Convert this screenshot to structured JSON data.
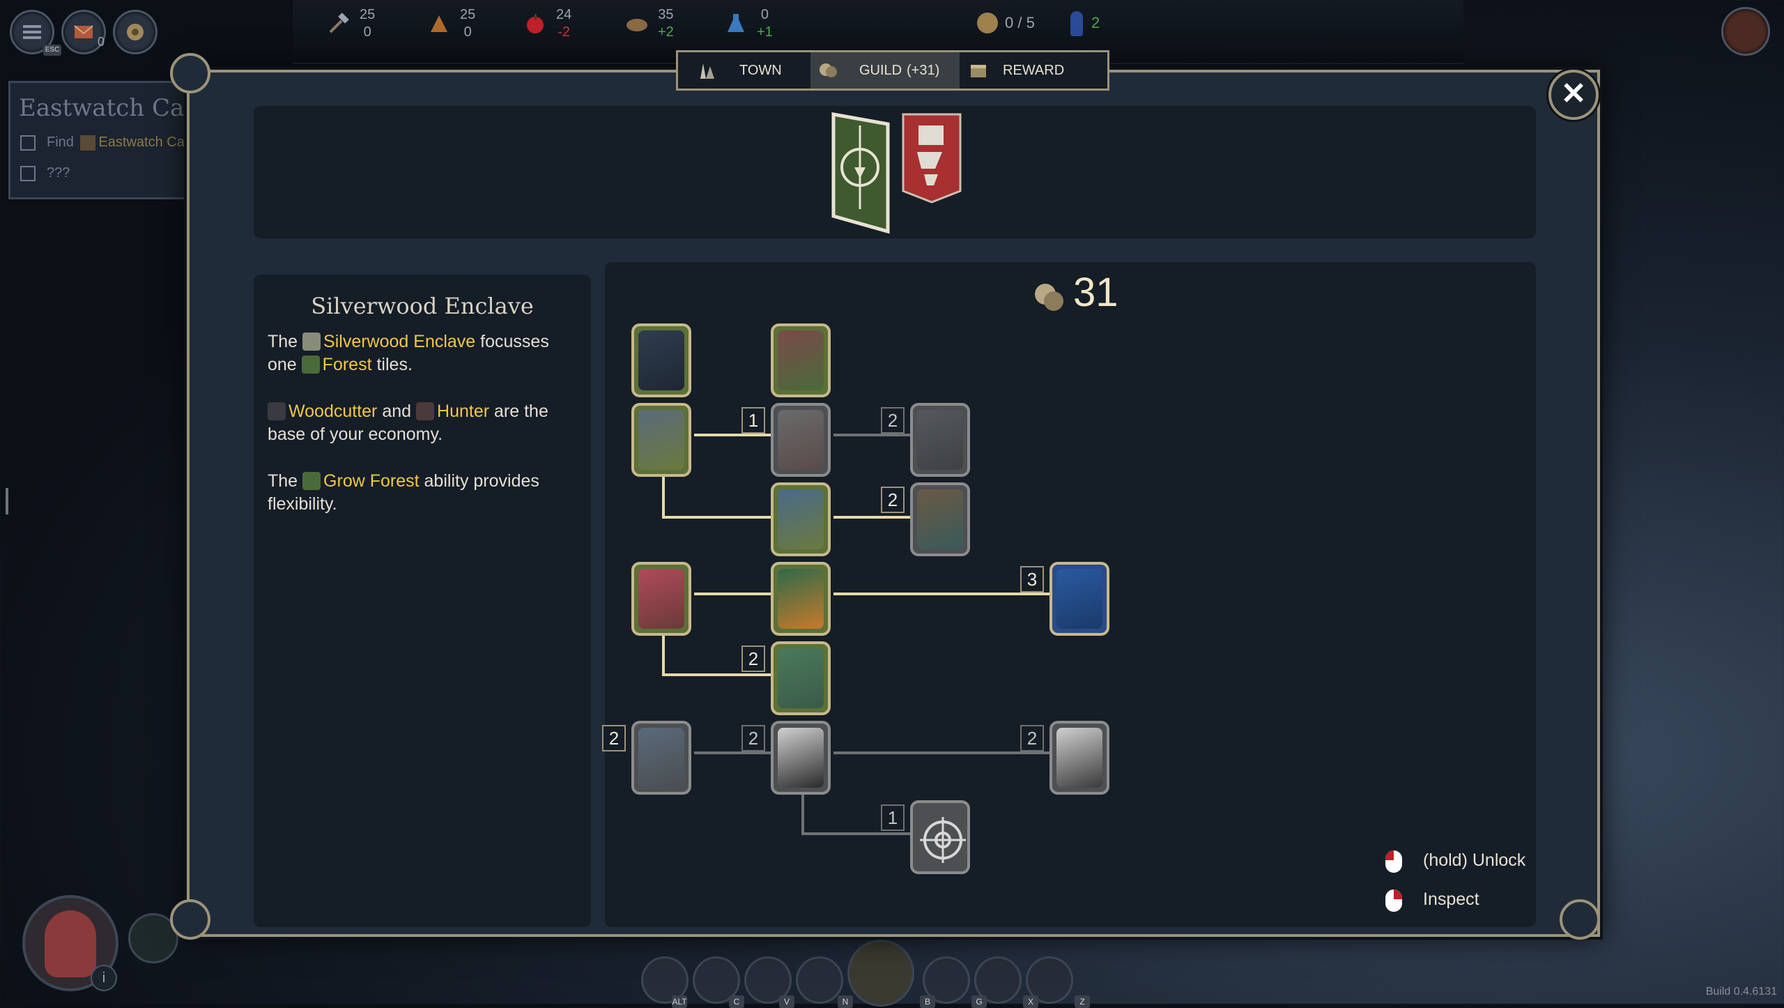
{
  "hud": {
    "esc_key": "ESC",
    "mail_count": "0",
    "resources": [
      {
        "icon": "hammer-icon",
        "top": "25",
        "bottom": "0",
        "bottom_color": "#9aa4b2"
      },
      {
        "icon": "wood-icon",
        "top": "25",
        "bottom": "0",
        "bottom_color": "#9aa4b2"
      },
      {
        "icon": "apple-icon",
        "top": "24",
        "bottom": "-2",
        "bottom_color": "#c03a3a"
      },
      {
        "icon": "bread-icon",
        "top": "35",
        "bottom": "+2",
        "bottom_color": "#4ca84c"
      },
      {
        "icon": "potion-icon",
        "top": "0",
        "bottom": "+1",
        "bottom_color": "#4ca84c"
      }
    ],
    "population": "0 / 5",
    "workers": "2"
  },
  "quest": {
    "title": "Eastwatch Castl",
    "items": [
      {
        "prefix": "Find",
        "target": "Eastwatch Ca"
      },
      {
        "prefix": "???",
        "target": ""
      }
    ]
  },
  "tabs": [
    {
      "label": "TOWN",
      "icon": "town-icon"
    },
    {
      "label": "GUILD",
      "icon": "guild-icon",
      "extra": "(+31)"
    },
    {
      "label": "REWARD",
      "icon": "reward-icon"
    }
  ],
  "faction": {
    "name": "Silverwood Enclave",
    "p1": {
      "a": "The",
      "b": "Silverwood Enclave",
      "c": "focusses one",
      "d": "Forest",
      "e": "tiles."
    },
    "p2": {
      "a": "Woodcutter",
      "b": "and",
      "c": "Hunter",
      "d": "are the base of your economy."
    },
    "p3": {
      "a": "The",
      "b": "Grow Forest",
      "c": "ability provides flexibility."
    }
  },
  "points": "31",
  "tree": {
    "costs": [
      "1",
      "2",
      "2",
      "3",
      "2",
      "2",
      "2",
      "2",
      "1"
    ]
  },
  "legend": {
    "unlock": "(hold) Unlock",
    "inspect": "Inspect"
  },
  "bottom_keys": [
    "ALT",
    "C",
    "V",
    "N",
    "B",
    "G",
    "X",
    "Z"
  ],
  "build": "Build 0.4.6131"
}
